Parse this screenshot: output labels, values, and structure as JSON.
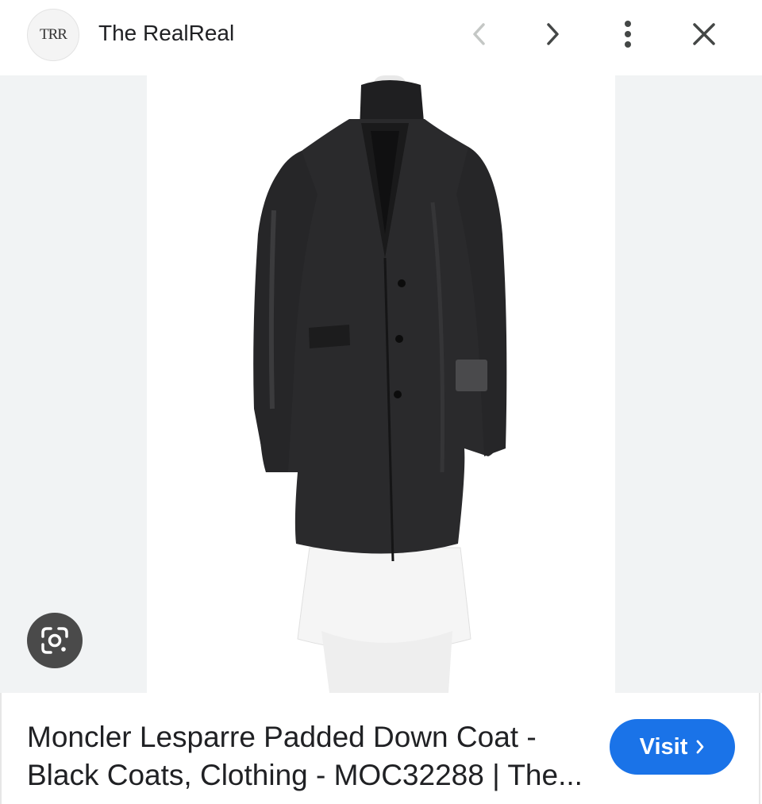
{
  "header": {
    "logo_text": "TRR",
    "site_name": "The RealReal",
    "icons": [
      "chevron-left-icon",
      "chevron-right-icon",
      "more-vert-icon",
      "close-icon"
    ]
  },
  "image": {
    "alt": "Moncler Lesparre Padded Down Coat",
    "background_color": "#f1f3f4"
  },
  "lens_icon": "google-lens-icon",
  "caption": {
    "line1": "Moncler Lesparre Padded Down Coat -",
    "line2": "Black Coats, Clothing - MOC32288 | The..."
  },
  "visit_button": {
    "label": "Visit",
    "color": "#1a73e8"
  }
}
